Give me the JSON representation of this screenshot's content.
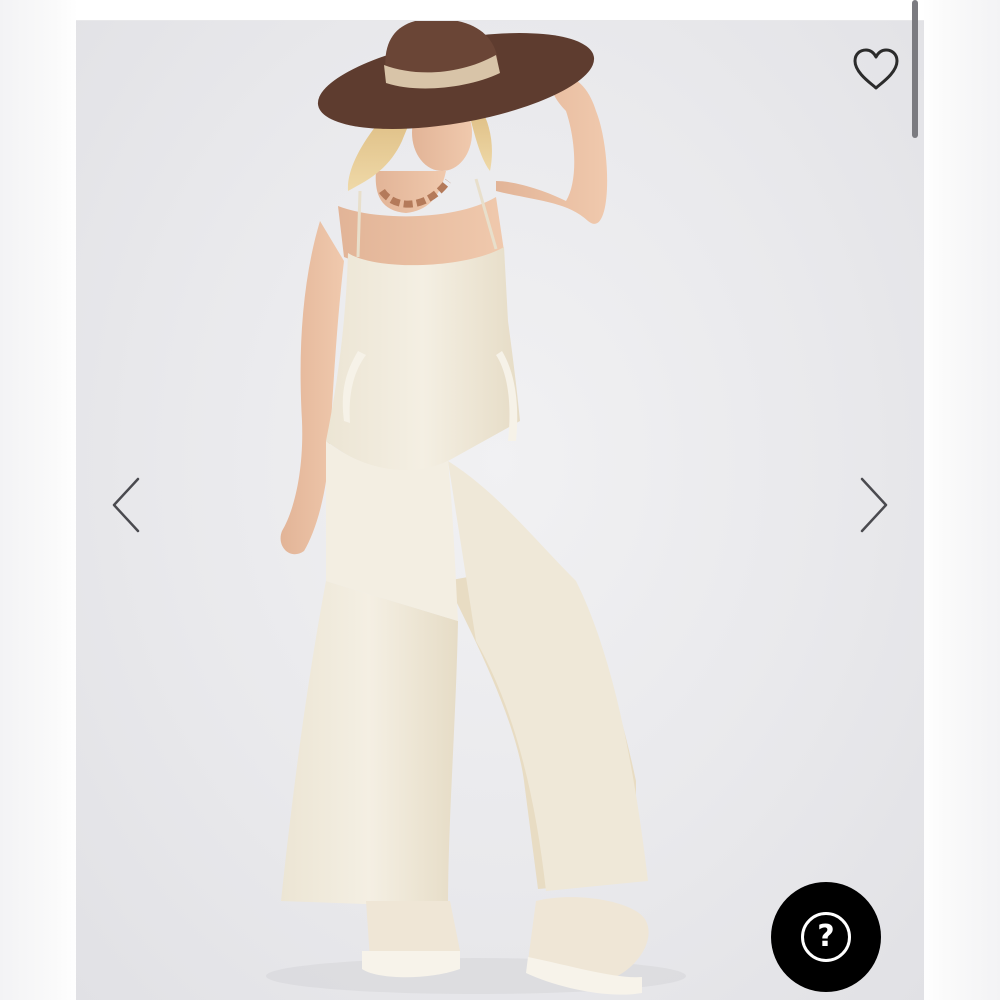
{
  "product_image": {
    "alt": ""
  },
  "favorite": {
    "icon": "heart-outline-icon",
    "color": "#2b2b2b"
  },
  "carousel": {
    "prev_icon": "chevron-left-icon",
    "next_icon": "chevron-right-icon",
    "arrow_color": "#4a4a4f"
  },
  "help": {
    "icon": "question-circle-icon",
    "label": "?",
    "background": "#000000"
  },
  "colors": {
    "photo_background": "#e9e9ec",
    "jumpsuit": "#f1ecdf",
    "hat": "#5e3c2f",
    "hat_band": "#d8c4a8"
  }
}
